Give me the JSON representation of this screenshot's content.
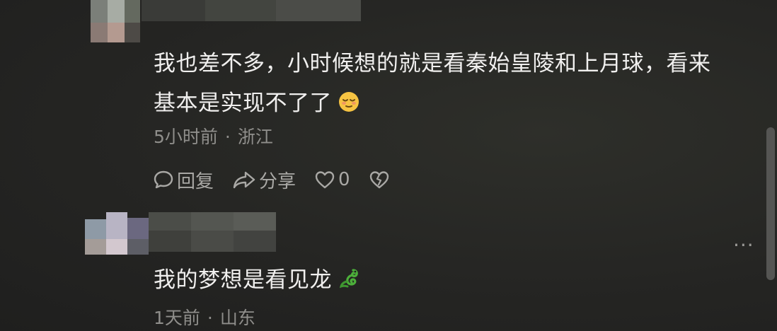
{
  "comments": [
    {
      "text_line1": "我也差不多，小时候想的就是看秦始皇陵和上月球，看来",
      "text_line2": "基本是实现不了了",
      "emoji": "relieved-face-emoji",
      "time": "5小时前",
      "separator": "·",
      "location": "浙江",
      "actions": {
        "reply_label": "回复",
        "share_label": "分享",
        "like_count": "0"
      }
    },
    {
      "text": "我的梦想是看见龙",
      "emoji": "dragon-emoji",
      "time": "1天前",
      "separator": "·",
      "location": "山东",
      "more_label": "···"
    }
  ],
  "colors": {
    "background": "#262624",
    "text": "#f0efee",
    "meta": "#8f8e8b",
    "emoji_green": "#4caf3a",
    "emoji_yellow": "#f6c342"
  }
}
